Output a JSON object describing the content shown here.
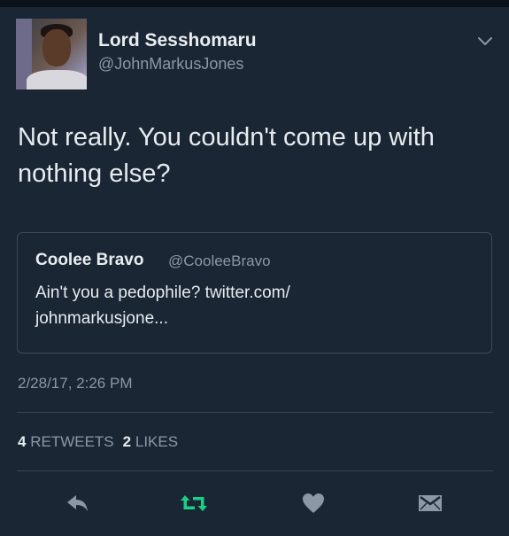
{
  "tweet": {
    "author": {
      "display_name": "Lord Sesshomaru",
      "handle": "@JohnMarkusJones"
    },
    "text_line1": "Not really. You couldn't come up with",
    "text_line2": "nothing else?",
    "quoted": {
      "display_name": "Coolee Bravo",
      "handle": "@CooleeBravo",
      "text_line1": "Ain't you a pedophile? twitter.com/",
      "text_line2": "johnmarkusjone..."
    },
    "timestamp": "2/28/17, 2:26 PM",
    "stats": {
      "retweets_count": "4",
      "retweets_label": "RETWEETS",
      "likes_count": "2",
      "likes_label": "LIKES"
    }
  },
  "icons": {
    "reply": "reply-icon",
    "retweet": "retweet-icon",
    "like": "heart-icon",
    "dm": "envelope-icon",
    "more": "chevron-down-icon"
  },
  "colors": {
    "background": "#1a2633",
    "retweet_active": "#19cf86",
    "muted": "#8b98a5"
  }
}
